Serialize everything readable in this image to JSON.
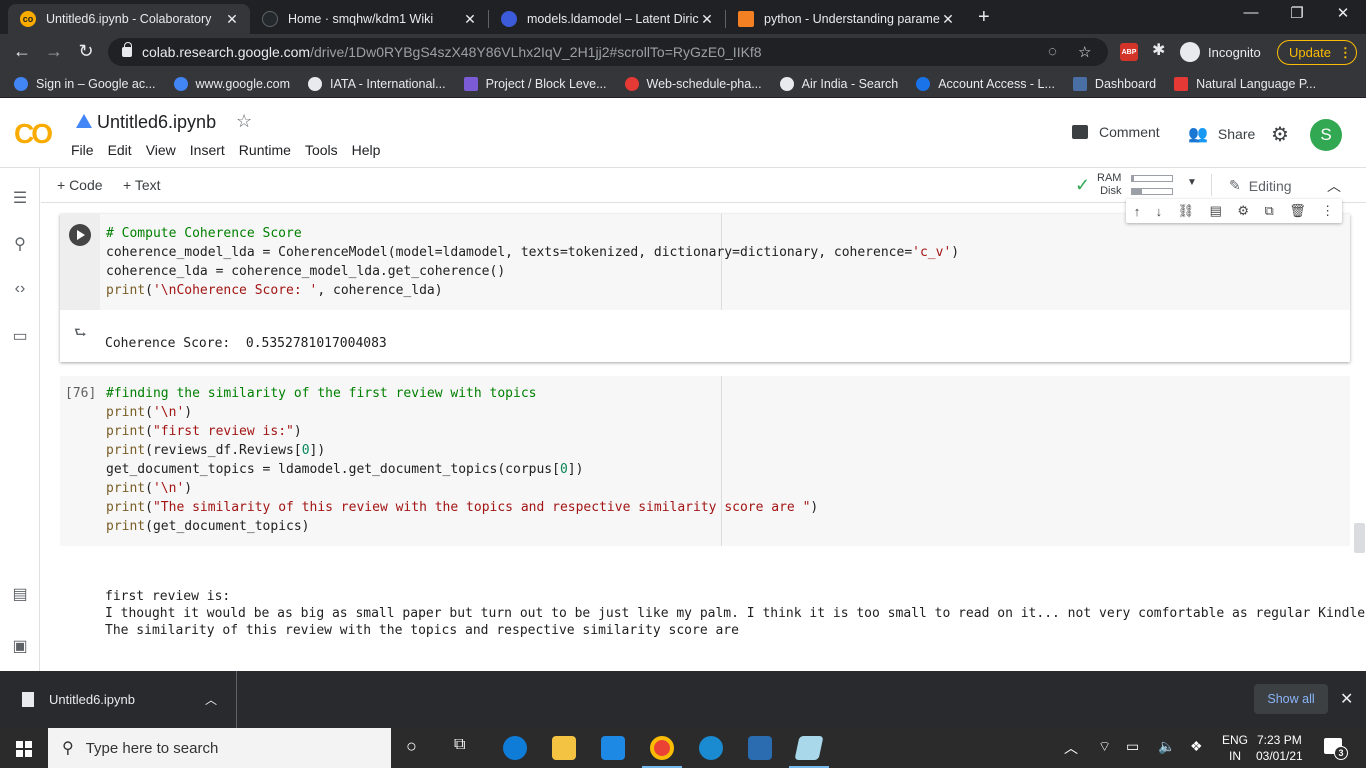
{
  "browser": {
    "tabs": [
      {
        "label": "Untitled6.ipynb - Colaboratory",
        "active": true,
        "favicon_color": "#f9ab00"
      },
      {
        "label": "Home · smqhw/kdm1 Wiki",
        "active": false,
        "favicon_color": "#24292e"
      },
      {
        "label": "models.ldamodel – Latent Dirichl",
        "active": false,
        "favicon_color": "#3b5bdb"
      },
      {
        "label": "python - Understanding paramet",
        "active": false,
        "favicon_color": "#f48024"
      }
    ],
    "tab_close_glyph": "✕",
    "new_tab_glyph": "+",
    "window_controls": [
      "—",
      "❐",
      "✕"
    ],
    "url_host": "colab.research.google.com",
    "url_path": "/drive/1Dw0RYBgS4szX48Y86VLhx2IqV_2H1jj2#scrollTo=RyGzE0_IIKf8",
    "abp_label": "ABP",
    "incognito_label": "Incognito",
    "update_label": "Update",
    "bookmarks": [
      {
        "label": "Sign in – Google ac...",
        "color": "#4285f4"
      },
      {
        "label": "www.google.com",
        "color": "#4285f4"
      },
      {
        "label": "IATA - International...",
        "color": "#e8eaed"
      },
      {
        "label": "Project / Block Leve...",
        "color": "#7b5cd6"
      },
      {
        "label": "Web-schedule-pha...",
        "color": "#e53935"
      },
      {
        "label": "Air India - Search",
        "color": "#e8eaed"
      },
      {
        "label": "Account Access - L...",
        "color": "#1a73e8"
      },
      {
        "label": "Dashboard",
        "color": "#4a6fa5"
      },
      {
        "label": "Natural Language P...",
        "color": "#e53935"
      }
    ]
  },
  "colab": {
    "logo_text": "CO",
    "notebook_title": "Untitled6.ipynb",
    "menu": [
      "File",
      "Edit",
      "View",
      "Insert",
      "Runtime",
      "Tools",
      "Help"
    ],
    "comment_label": "Comment",
    "share_label": "Share",
    "avatar_letter": "S",
    "avatar_color": "#33a852",
    "add_code_label": "+ Code",
    "add_text_label": "+ Text",
    "ram_label": "RAM",
    "disk_label": "Disk",
    "ram_usage": 0.05,
    "disk_usage": 0.25,
    "editing_label": "Editing"
  },
  "cells": {
    "cell1": {
      "code_lines": [
        [
          {
            "t": "# Compute Coherence Score",
            "c": "cm"
          }
        ],
        [
          {
            "t": "coherence_model_lda = CoherenceModel(model=ldamodel, texts=tokenized, dictionary=dictionary, coherence="
          },
          {
            "t": "'c_v'",
            "c": "str"
          },
          {
            "t": ")"
          }
        ],
        [
          {
            "t": "coherence_lda = coherence_model_lda.get_coherence()"
          }
        ],
        [
          {
            "t": "print",
            "c": "fn"
          },
          {
            "t": "("
          },
          {
            "t": "'\\nCoherence Score: '",
            "c": "str"
          },
          {
            "t": ", coherence_lda)"
          }
        ]
      ],
      "output": "Coherence Score:  0.5352781017004083"
    },
    "cell2": {
      "exec_count": "[76]",
      "code_lines": [
        [
          {
            "t": "#finding the similarity of the first review with topics",
            "c": "cm"
          }
        ],
        [
          {
            "t": "print",
            "c": "fn"
          },
          {
            "t": "("
          },
          {
            "t": "'\\n'",
            "c": "str"
          },
          {
            "t": ")"
          }
        ],
        [
          {
            "t": "print",
            "c": "fn"
          },
          {
            "t": "("
          },
          {
            "t": "\"first review is:\"",
            "c": "str"
          },
          {
            "t": ")"
          }
        ],
        [
          {
            "t": "print",
            "c": "fn"
          },
          {
            "t": "(reviews_df.Reviews["
          },
          {
            "t": "0",
            "c": "num"
          },
          {
            "t": "])"
          }
        ],
        [
          {
            "t": "get_document_topics = ldamodel.get_document_topics(corpus["
          },
          {
            "t": "0",
            "c": "num"
          },
          {
            "t": "])"
          }
        ],
        [
          {
            "t": "print",
            "c": "fn"
          },
          {
            "t": "("
          },
          {
            "t": "'\\n'",
            "c": "str"
          },
          {
            "t": ")"
          }
        ],
        [
          {
            "t": "print",
            "c": "fn"
          },
          {
            "t": "("
          },
          {
            "t": "\"The similarity of this review with the topics and respective similarity score are \"",
            "c": "str"
          },
          {
            "t": ")"
          }
        ],
        [
          {
            "t": "print",
            "c": "fn"
          },
          {
            "t": "(get_document_topics)"
          }
        ]
      ],
      "output_lines": [
        "first review is:",
        "I thought it would be as big as small paper but turn out to be just like my palm. I think it is too small to read on it... not very comfortable as regular Kindle.",
        "",
        "The similarity of this review with the topics and respective similarity score are"
      ]
    }
  },
  "download_bar": {
    "file_name": "Untitled6.ipynb",
    "show_all_label": "Show all"
  },
  "taskbar": {
    "search_placeholder": "Type here to search",
    "lang_line1": "ENG",
    "lang_line2": "IN",
    "time": "7:23 PM",
    "date": "03/01/21",
    "notification_count": "3"
  }
}
